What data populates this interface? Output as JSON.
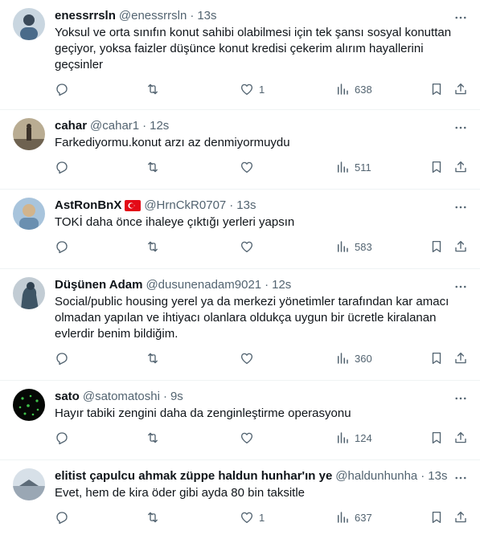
{
  "tweets": [
    {
      "name": "enessrrsln",
      "handle": "@enessrrsln",
      "time": "13s",
      "text": "Yoksul ve orta sınıfın konut sahibi olabilmesi için tek şansı sosyal konuttan geçiyor, yoksa faizler düşünce konut kredisi çekerim alırım hayallerini geçsinler",
      "likes": "1",
      "views": "638",
      "avatar_color": "#4a6b8a"
    },
    {
      "name": "cahar",
      "handle": "@cahar1",
      "time": "12s",
      "text": "Farkediyormu.konut arzı az denmiyormuydu",
      "likes": "",
      "views": "511",
      "avatar_color": "#8b7b62"
    },
    {
      "name": "AstRonBnX",
      "handle": "@HrnCkR0707",
      "time": "13s",
      "text": "TOKİ daha önce ihaleye çıktığı yerleri yapsın",
      "likes": "",
      "views": "583",
      "avatar_color": "#6a8fb0"
    },
    {
      "name": "Düşünen Adam",
      "handle": "@dusunenadam9021",
      "time": "12s",
      "text": "Social/public housing yerel ya da merkezi yönetimler tarafından kar amacı olmadan yapılan ve ihtiyacı olanlara oldukça uygun bir ücretle kiralanan evlerdir benim bildiğim.",
      "likes": "",
      "views": "360",
      "avatar_color": "#3e5566"
    },
    {
      "name": "sato",
      "handle": "@satomatoshi",
      "time": "9s",
      "text": "Hayır tabiki zengini daha da zenginleştirme operasyonu",
      "likes": "",
      "views": "124",
      "avatar_color": "#0a0a0a"
    },
    {
      "name": "elitist çapulcu ahmak züppe haldun hunhar'ın ye",
      "handle": "@haldunhunha",
      "time": "13s",
      "text": "Evet, hem de kira öder gibi ayda 80 bin taksitle",
      "likes": "1",
      "views": "637",
      "avatar_color": "#9aa7b4"
    }
  ],
  "separator": "·",
  "colors": {
    "text": "#0f1419",
    "secondary": "#536471",
    "border": "#eff3f4",
    "flag_red": "#e30a17"
  }
}
